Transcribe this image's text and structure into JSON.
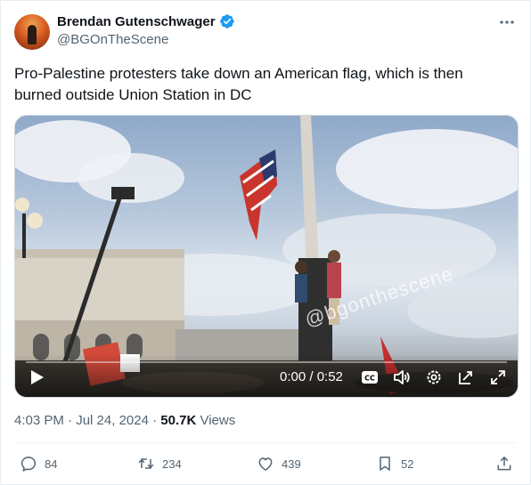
{
  "author": {
    "name": "Brendan Gutenschwager",
    "handle": "@BGOnTheScene"
  },
  "tweet": {
    "text": "Pro-Palestine protesters take down an American flag, which is then burned outside Union Station in DC"
  },
  "video": {
    "watermark": "@bgonthescene",
    "time": "0:00 / 0:52",
    "progress": 0
  },
  "meta": {
    "time": "4:03 PM",
    "sep1": " · ",
    "date": "Jul 24, 2024",
    "sep2": " · ",
    "views_count": "50.7K",
    "views_label": " Views"
  },
  "actions": {
    "replies": "84",
    "reposts": "234",
    "likes": "439",
    "bookmarks": "52"
  },
  "colors": {
    "verified": "#1d9bf0",
    "secondary_text": "#536471",
    "primary_text": "#0f1419"
  },
  "icons": [
    "verified-badge-icon",
    "more-icon",
    "play-icon",
    "captions-icon",
    "volume-icon",
    "settings-icon",
    "popout-icon",
    "fullscreen-icon",
    "reply-icon",
    "repost-icon",
    "like-icon",
    "bookmark-icon",
    "share-icon"
  ]
}
